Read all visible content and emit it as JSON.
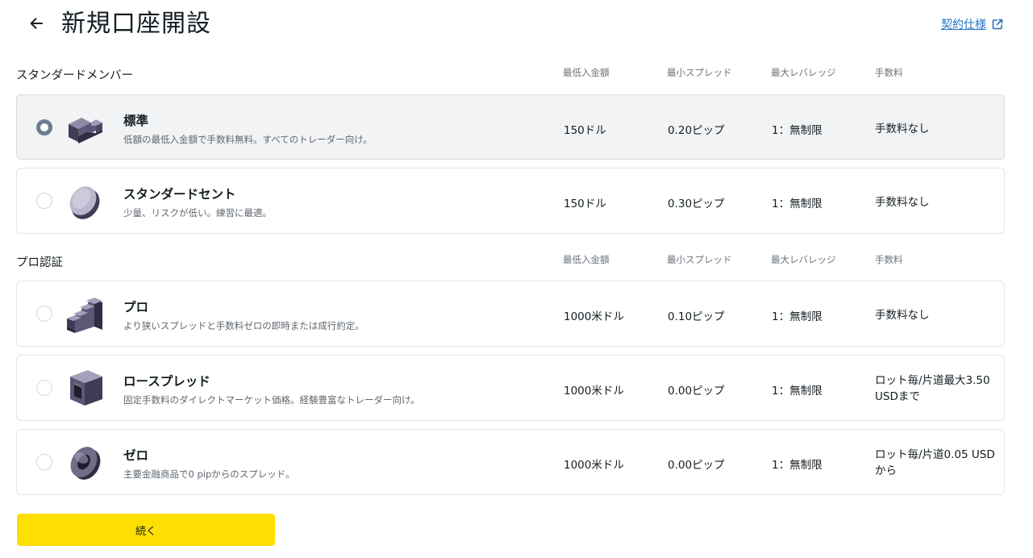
{
  "header": {
    "title": "新規口座開設",
    "spec_link": "契約仕様"
  },
  "columns": {
    "min_deposit": "最低入金額",
    "min_spread": "最小スプレッド",
    "max_leverage": "最大レバレッジ",
    "commission": "手数料"
  },
  "sections": [
    {
      "title": "スタンダードメンバー",
      "accounts": [
        {
          "name": "標準",
          "description": "低額の最低入金額で手数料無料。すべてのトレーダー向け。",
          "min_deposit": "150ドル",
          "min_spread": "0.20ピップ",
          "max_leverage": "1：無制限",
          "commission": "手数料なし",
          "selected": true,
          "icon": "standard-block-icon"
        },
        {
          "name": "スタンダードセント",
          "description": "少量、リスクが低い。練習に最適。",
          "min_deposit": "150ドル",
          "min_spread": "0.30ピップ",
          "max_leverage": "1：無制限",
          "commission": "手数料なし",
          "selected": false,
          "icon": "coin-icon"
        }
      ]
    },
    {
      "title": "プロ認証",
      "accounts": [
        {
          "name": "プロ",
          "description": "より狭いスプレッドと手数料ゼロの即時または成行約定。",
          "min_deposit": "1000米ドル",
          "min_spread": "0.10ピップ",
          "max_leverage": "1：無制限",
          "commission": "手数料なし",
          "selected": false,
          "icon": "stairs-icon"
        },
        {
          "name": "ロースプレッド",
          "description": "固定手数料のダイレクトマーケット価格。経験豊富なトレーダー向け。",
          "min_deposit": "1000米ドル",
          "min_spread": "0.00ピップ",
          "max_leverage": "1：無制限",
          "commission": "ロット毎/片道最大3.50 USDまで",
          "selected": false,
          "icon": "frame-block-icon"
        },
        {
          "name": "ゼロ",
          "description": "主要金融商品で0 pipからのスプレッド。",
          "min_deposit": "1000米ドル",
          "min_spread": "0.00ピップ",
          "max_leverage": "1：無制限",
          "commission": "ロット毎/片道0.05 USDから",
          "selected": false,
          "icon": "ring-icon"
        }
      ]
    }
  ],
  "continue_label": "続く",
  "colors": {
    "accent": "#ffde02",
    "link": "#2573c7",
    "selected_bg": "#f2f3f5",
    "radio_checked": "#6d7d8f",
    "icon_dark": "#3f3d56"
  }
}
